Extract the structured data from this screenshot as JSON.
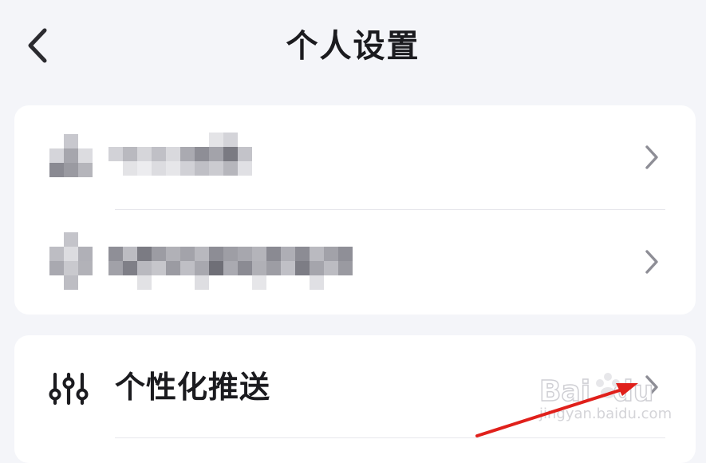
{
  "header": {
    "title": "个人设置",
    "back_icon": "chevron-left-icon"
  },
  "account_card": {
    "rows": [
      {
        "label": "",
        "pixelated": true,
        "chevron_icon": "chevron-right-icon"
      },
      {
        "label": "",
        "pixelated": true,
        "chevron_icon": "chevron-right-icon"
      }
    ]
  },
  "preferences_card": {
    "rows": [
      {
        "icon": "sliders-icon",
        "label": "个性化推送",
        "chevron_icon": "chevron-right-icon"
      }
    ]
  },
  "watermark": {
    "logo": "Bai du",
    "url": "jingyan.baidu.com"
  },
  "annotation": {
    "type": "red-arrow",
    "color": "#e0201b"
  },
  "colors": {
    "background": "#f4f5f9",
    "card": "#ffffff",
    "text": "#1b1b1f",
    "chevron": "#8e8e96",
    "divider": "#e7e7ec"
  }
}
